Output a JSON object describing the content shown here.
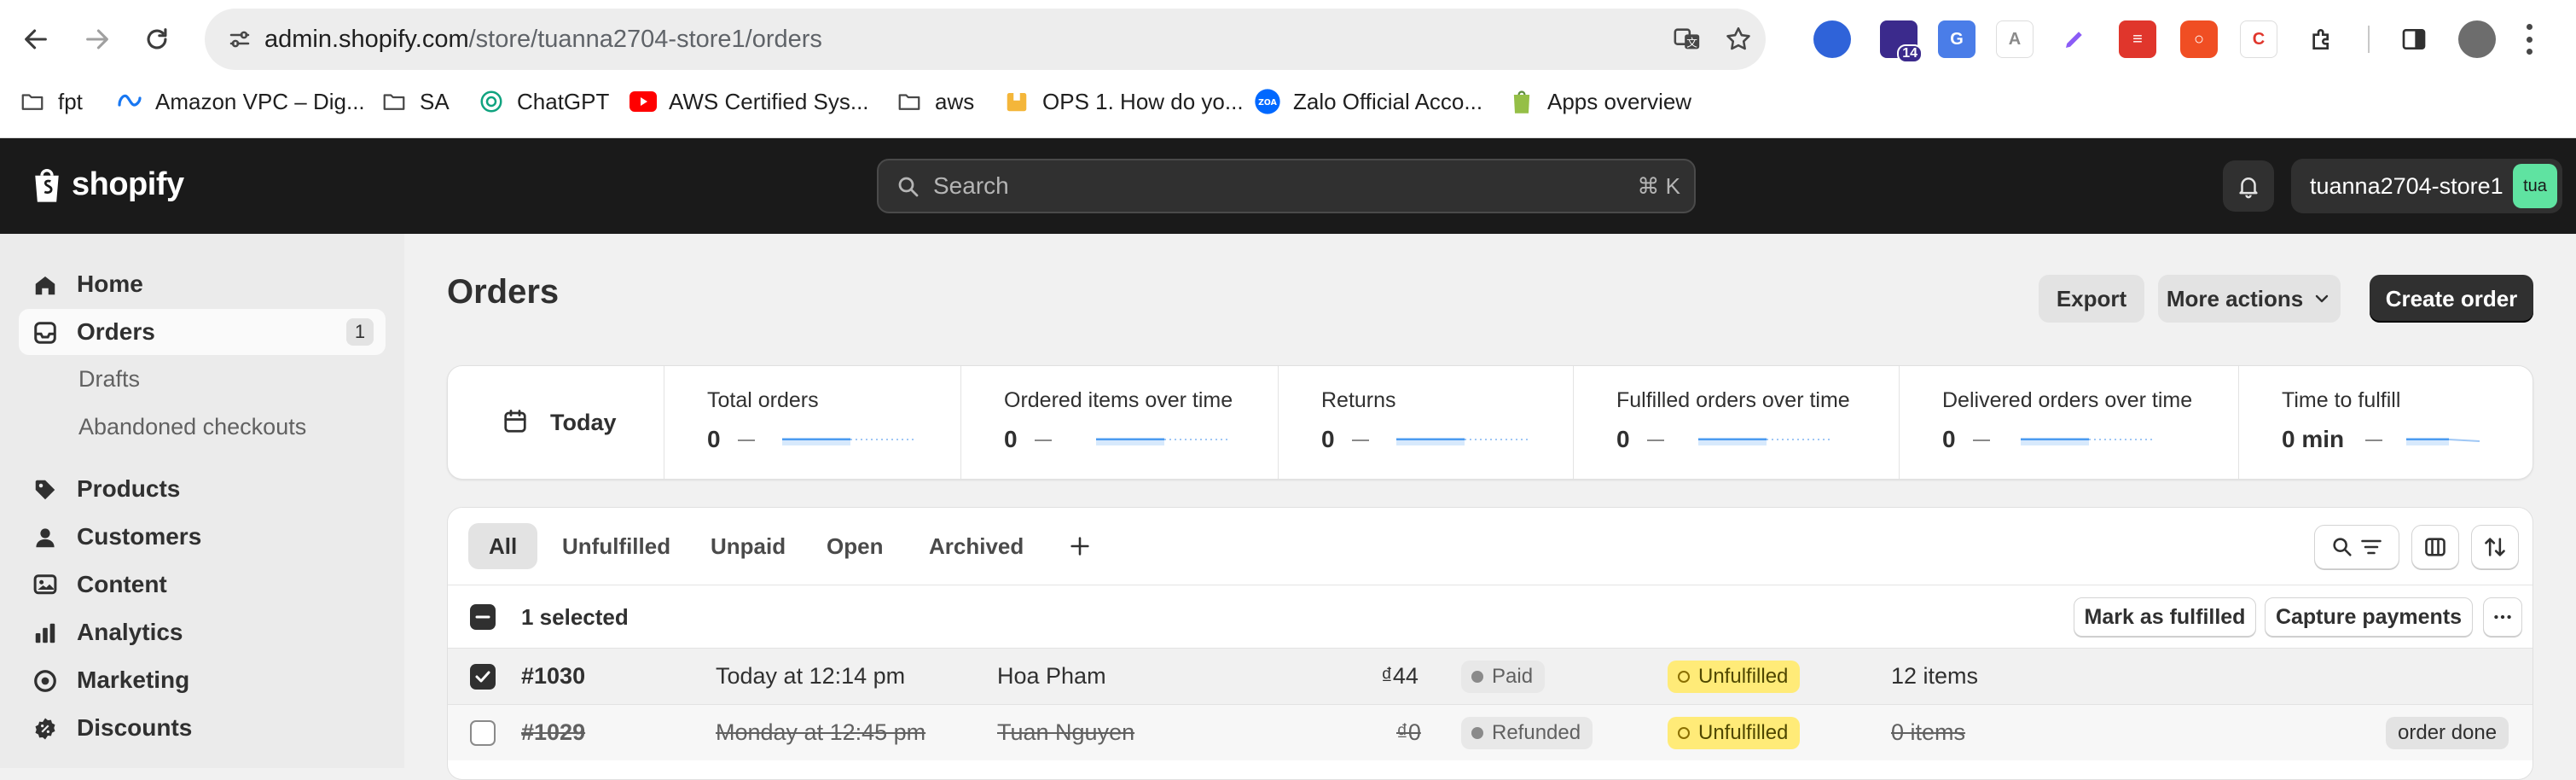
{
  "browser": {
    "url_host": "admin.shopify.com",
    "url_path": "/store/tuanna2704-store1/orders",
    "extension_badge": "14"
  },
  "bookmarks": [
    {
      "label": "fpt",
      "icon": "folder-icon"
    },
    {
      "label": "Amazon VPC – Dig...",
      "icon": "meta-icon"
    },
    {
      "label": "SA",
      "icon": "folder-icon"
    },
    {
      "label": "ChatGPT",
      "icon": "chatgpt-icon"
    },
    {
      "label": "AWS Certified Sys...",
      "icon": "youtube-icon"
    },
    {
      "label": "aws",
      "icon": "folder-icon"
    },
    {
      "label": "OPS 1. How do yo...",
      "icon": "package-icon"
    },
    {
      "label": "Zalo Official Acco...",
      "icon": "zalo-icon"
    },
    {
      "label": "Apps overview",
      "icon": "shopify-bag-icon"
    }
  ],
  "topbar": {
    "logo_text": "shopify",
    "search_placeholder": "Search",
    "search_shortcut": "⌘ K",
    "store_name": "tuanna2704-store1",
    "avatar_text": "tua"
  },
  "sidebar": {
    "items": [
      {
        "label": "Home",
        "icon": "home-icon"
      },
      {
        "label": "Orders",
        "icon": "orders-icon",
        "badge": "1"
      },
      {
        "label": "Drafts"
      },
      {
        "label": "Abandoned checkouts"
      },
      {
        "label": "Products",
        "icon": "tag-icon"
      },
      {
        "label": "Customers",
        "icon": "person-icon"
      },
      {
        "label": "Content",
        "icon": "content-icon"
      },
      {
        "label": "Analytics",
        "icon": "bar-chart-icon"
      },
      {
        "label": "Marketing",
        "icon": "target-icon"
      },
      {
        "label": "Discounts",
        "icon": "discount-icon"
      }
    ]
  },
  "page": {
    "title": "Orders",
    "export_label": "Export",
    "more_actions_label": "More actions",
    "create_label": "Create order"
  },
  "metrics": {
    "date_label": "Today",
    "items": [
      {
        "title": "Total orders",
        "value": "0"
      },
      {
        "title": "Ordered items over time",
        "value": "0"
      },
      {
        "title": "Returns",
        "value": "0"
      },
      {
        "title": "Fulfilled orders over time",
        "value": "0"
      },
      {
        "title": "Delivered orders over time",
        "value": "0"
      },
      {
        "title": "Time to fulfill",
        "value": "0 min"
      }
    ]
  },
  "tabs": [
    "All",
    "Unfulfilled",
    "Unpaid",
    "Open",
    "Archived"
  ],
  "bulk": {
    "selected_text": "1 selected",
    "mark_fulfilled_label": "Mark as fulfilled",
    "capture_label": "Capture payments"
  },
  "orders": [
    {
      "id": "#1030",
      "date": "Today at 12:14 pm",
      "customer": "Hoa Pham",
      "total": "₫44",
      "payment": "Paid",
      "fulfillment": "Unfulfilled",
      "items": "12 items",
      "tag": "",
      "checked": true
    },
    {
      "id": "#1029",
      "date": "Monday at 12:45 pm",
      "customer": "Tuan Nguyen",
      "total": "₫0",
      "payment": "Refunded",
      "fulfillment": "Unfulfilled",
      "items": "0 items",
      "tag": "order done",
      "checked": false
    }
  ],
  "colors": {
    "topbar_bg": "#1a1a1a",
    "sidebar_bg": "#ebebeb",
    "primary_button": "#303030",
    "avatar_green": "#5fe3a1",
    "unfulfilled_badge": "#ffeb78",
    "sparkline_blue": "#4b9bf0"
  }
}
